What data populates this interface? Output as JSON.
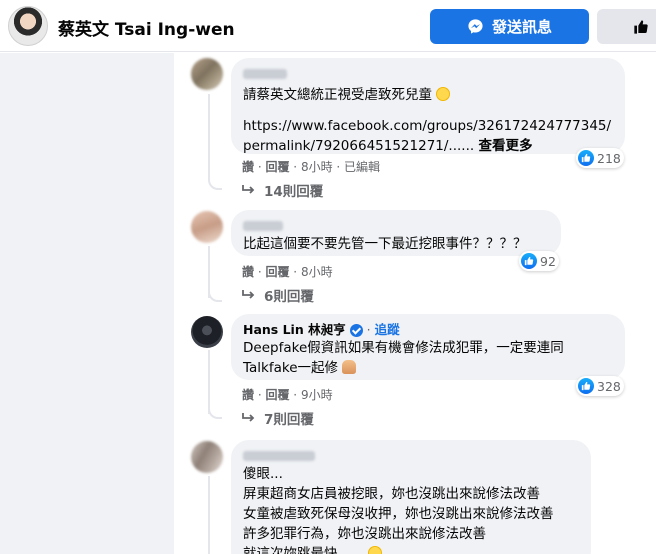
{
  "header": {
    "name": "蔡英文 Tsai Ing-wen",
    "message_button": "發送訊息"
  },
  "comments": [
    {
      "text_lines": [
        "請蔡英文總統正視受虐致死兒童",
        "",
        "https://www.facebook.com/groups/326172424777345/",
        "permalink/792066451521271/......"
      ],
      "see_more": "查看更多",
      "reactions": "218",
      "actions": {
        "like": "讚",
        "reply": "回覆",
        "time": "8小時",
        "edited": "已編輯"
      },
      "replies": "14則回覆"
    },
    {
      "text_lines": [
        "比起這個要不要先管一下最近挖眼事件？？？？"
      ],
      "reactions": "92",
      "actions": {
        "like": "讚",
        "reply": "回覆",
        "time": "8小時"
      },
      "replies": "6則回覆"
    },
    {
      "author": "Hans Lin 林昶亨",
      "follow": "追蹤",
      "text_lines": [
        "Deepfake假資訊如果有機會修法成犯罪，一定要連同",
        "Talkfake一起修"
      ],
      "reactions": "328",
      "actions": {
        "like": "讚",
        "reply": "回覆",
        "time": "9小時"
      },
      "replies": "7則回覆"
    },
    {
      "text_lines": [
        "傻眼...",
        "屏東超商女店員被挖眼，妳也沒跳出來說修法改善",
        "女童被虐致死保母沒收押，妳也沒跳出來說修法改善",
        "許多犯罪行為，妳也沒跳出來說修法改善",
        "就這次妳跳最快......"
      ]
    }
  ],
  "separator": " · ",
  "colors": {
    "accent": "#1b74e4",
    "bubble": "#f0f2f5",
    "muted": "#65676b"
  },
  "icons": [
    "messenger-icon",
    "thumbs-up-icon",
    "reply-arrow-icon",
    "like-reaction-icon",
    "verified-icon"
  ]
}
